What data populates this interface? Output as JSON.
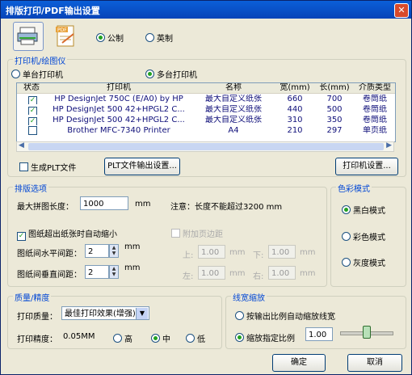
{
  "window": {
    "title": "排版打印/PDF输出设置",
    "close_glyph": "✕"
  },
  "unit": {
    "metric": "公制",
    "imperial": "英制",
    "selected": "metric"
  },
  "printer_group": {
    "title": "打印机/绘图仪",
    "single": "单台打印机",
    "multi": "多台打印机",
    "columns": [
      "状态",
      "打印机",
      "名称",
      "宽(mm)",
      "长(mm)",
      "介质类型"
    ],
    "rows": [
      {
        "checked": true,
        "printer": "HP DesignJet 750C (E/A0) by HP",
        "name": "最大自定义纸张",
        "width": "660",
        "length": "700",
        "media": "卷筒纸"
      },
      {
        "checked": true,
        "printer": "HP DesignJet 500 42+HPGL2 C...",
        "name": "最大自定义纸张",
        "width": "440",
        "length": "500",
        "media": "卷筒纸"
      },
      {
        "checked": true,
        "printer": "HP DesignJet 500 42+HPGL2 C...",
        "name": "最大自定义纸张",
        "width": "310",
        "length": "350",
        "media": "卷筒纸"
      },
      {
        "checked": false,
        "printer": "Brother MFC-7340 Printer",
        "name": "A4",
        "width": "210",
        "length": "297",
        "media": "单页纸"
      }
    ],
    "plt_file": "生成PLT文件",
    "plt_settings": "PLT文件输出设置...",
    "printer_settings": "打印机设置..."
  },
  "layout_group": {
    "title": "排版选项",
    "max_len_label": "最大拼图长度：",
    "max_len_value": "1000",
    "mm": "mm",
    "note": "注意：长度不能超过3200 mm",
    "auto_shrink": "图纸超出纸张时自动缩小",
    "margin_check": "附加页边距",
    "h_spacing_label": "图纸间水平间距：",
    "h_spacing_value": "2",
    "v_spacing_label": "图纸间垂直间距：",
    "v_spacing_value": "2",
    "top": "上:",
    "bottom": "下:",
    "left": "左:",
    "right": "右:",
    "margin_value": "1.00"
  },
  "color_group": {
    "title": "色彩模式",
    "bw": "黑白模式",
    "color": "彩色模式",
    "gray": "灰度模式"
  },
  "quality_group": {
    "title": "质量/精度",
    "quality_label": "打印质量：",
    "quality_value": "最佳打印效果(增强)",
    "precision_label": "打印精度：",
    "precision_value": "0.05MM",
    "high": "高",
    "mid": "中",
    "low": "低"
  },
  "linewidth_group": {
    "title": "线宽缩放",
    "auto": "按输出比例自动缩放线宽",
    "manual": "缩放指定比例",
    "manual_value": "1.00",
    "slider_level": 0.5
  },
  "buttons": {
    "ok": "确定",
    "cancel": "取消"
  }
}
